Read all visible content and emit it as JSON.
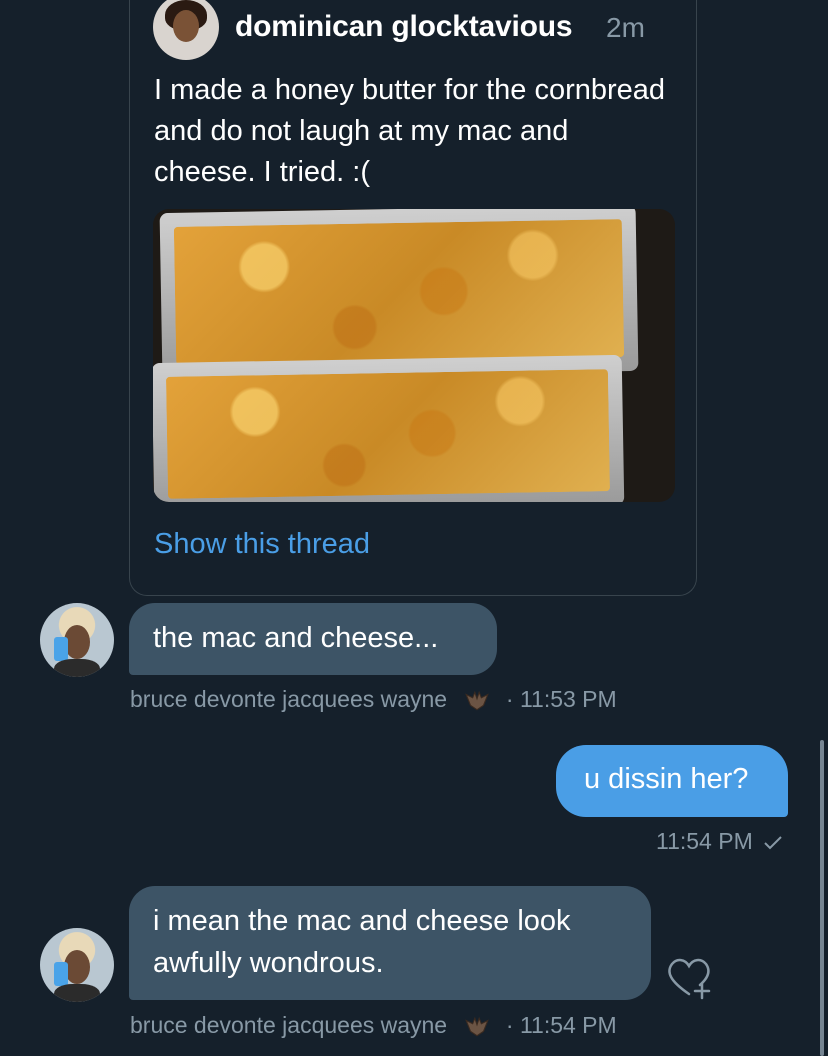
{
  "quoted_tweet": {
    "author_name": "dominican glocktavious",
    "timestamp": "2m",
    "text": "I made a honey butter for the cornbread and do not laugh at my mac and cheese. I tried. :(",
    "show_thread_label": "Show this thread"
  },
  "messages": [
    {
      "text": "the mac and cheese...",
      "sender": "bruce devonte jacquees wayne",
      "time": "· 11:53 PM"
    },
    {
      "text": "u dissin her?",
      "time": "11:54 PM",
      "status_icon": "checkmark-icon"
    },
    {
      "text": "i mean the mac and cheese look awfully wondrous.",
      "sender": "bruce devonte jacquees wayne",
      "time": "· 11:54 PM",
      "reaction_icon": "heart-plus-icon"
    }
  ],
  "colors": {
    "background": "#15202b",
    "incoming_bubble": "#3d5466",
    "outgoing_bubble": "#4a9ee6",
    "link": "#4a9ee6",
    "muted_text": "#8899a6"
  }
}
